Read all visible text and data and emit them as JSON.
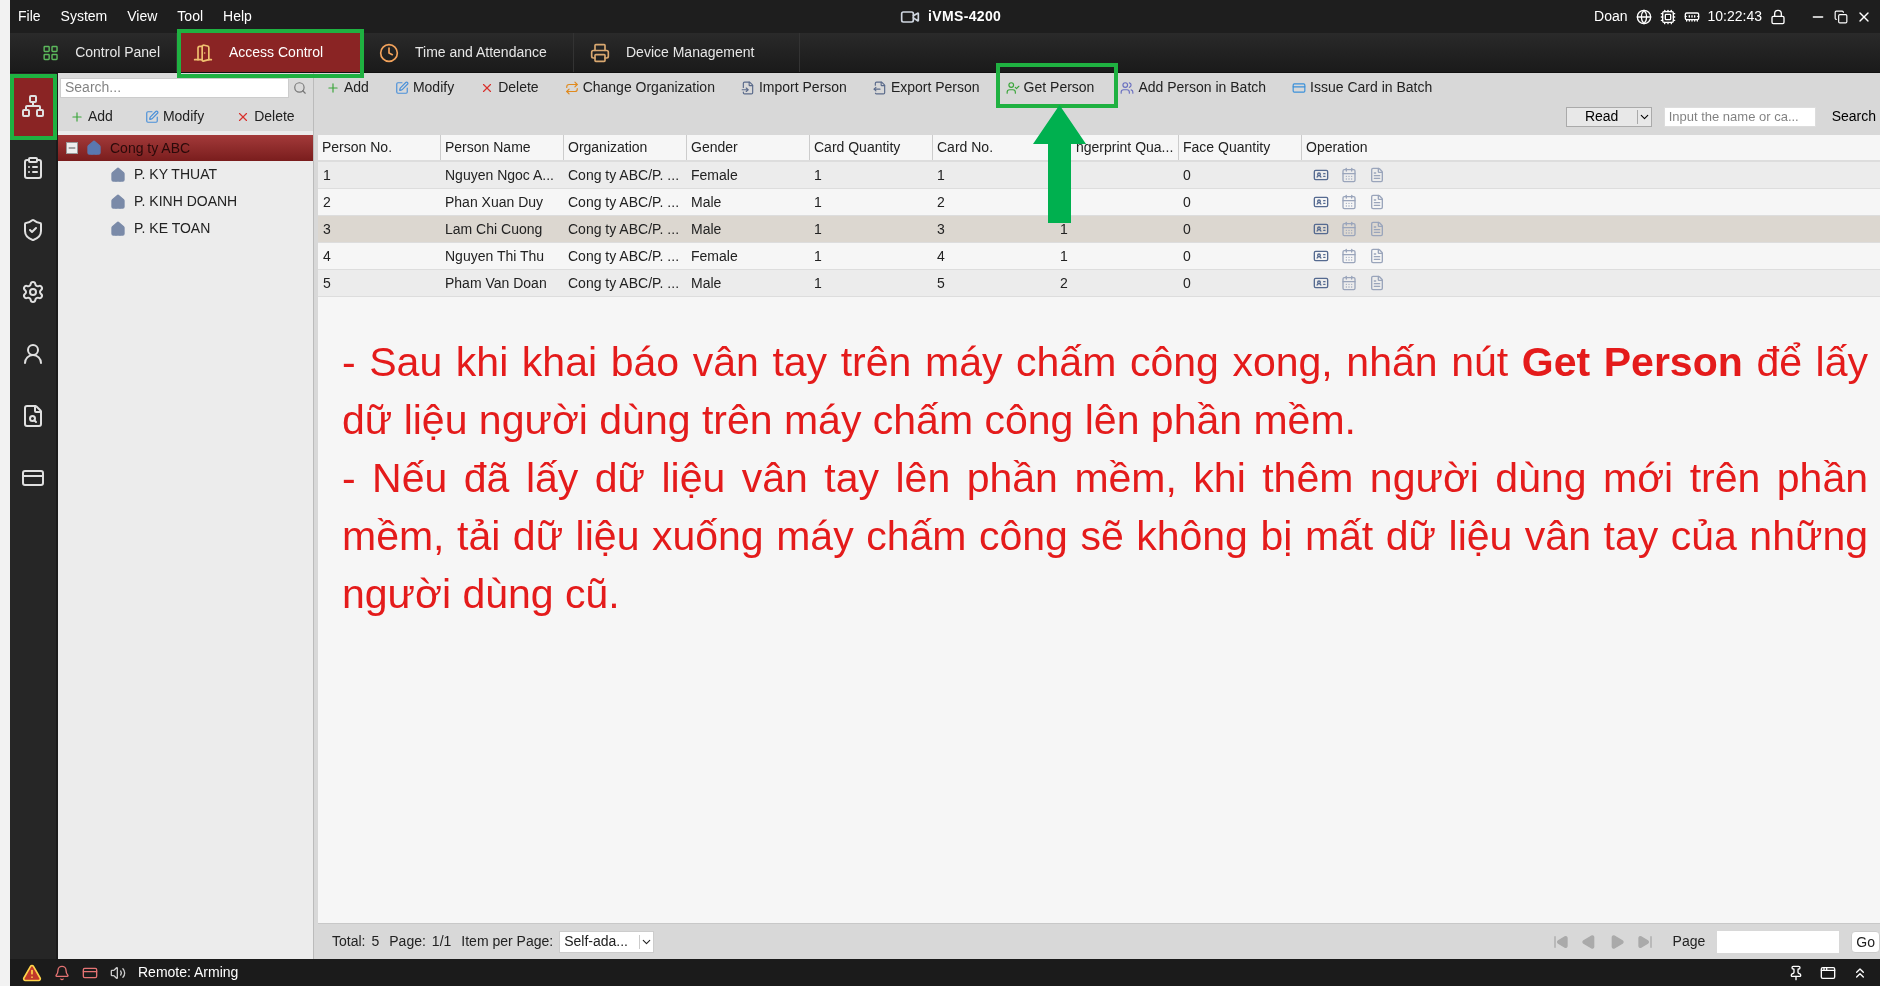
{
  "menu": [
    "File",
    "System",
    "View",
    "Tool",
    "Help"
  ],
  "window": {
    "title": "iVMS-4200",
    "user": "Doan",
    "time": "10:22:43"
  },
  "tabs": [
    {
      "label": "Control Panel",
      "kind": "grid",
      "selected": false
    },
    {
      "label": "Access Control",
      "kind": "door",
      "selected": true
    },
    {
      "label": "Time and Attendance",
      "kind": "clock",
      "selected": false
    },
    {
      "label": "Device Management",
      "kind": "device",
      "selected": false
    }
  ],
  "rail": [
    {
      "kind": "org",
      "selected": true
    },
    {
      "kind": "schedule",
      "selected": false
    },
    {
      "kind": "shield",
      "selected": false
    },
    {
      "kind": "gears",
      "selected": false
    },
    {
      "kind": "person",
      "selected": false
    },
    {
      "kind": "search",
      "selected": false
    },
    {
      "kind": "card",
      "selected": false
    }
  ],
  "tree_panel": {
    "search": {
      "placeholder": "Search..."
    },
    "toolbar": [
      {
        "label": "Add",
        "kind": "add"
      },
      {
        "label": "Modify",
        "kind": "modify"
      },
      {
        "label": "Delete",
        "kind": "delete"
      }
    ],
    "tree": [
      {
        "label": "Cong ty ABC",
        "selected": true,
        "expanded": true,
        "children": [
          {
            "label": "P. KY THUAT",
            "selected": false
          },
          {
            "label": "P. KINH DOANH",
            "selected": false
          },
          {
            "label": "P. KE TOAN",
            "selected": false
          }
        ]
      }
    ]
  },
  "toolbar": [
    {
      "label": "Add",
      "kind": "add"
    },
    {
      "label": "Modify",
      "kind": "modify"
    },
    {
      "label": "Delete",
      "kind": "delete"
    },
    {
      "label": "Change Organization",
      "kind": "org"
    },
    {
      "label": "Import Person",
      "kind": "import"
    },
    {
      "label": "Export Person",
      "kind": "export"
    },
    {
      "label": "Get Person",
      "kind": "get"
    },
    {
      "label": "Add Person in Batch",
      "kind": "batch"
    },
    {
      "label": "Issue Card in Batch",
      "kind": "card"
    }
  ],
  "filter": {
    "mode": "Read",
    "search": {
      "placeholder": "Input the name or ca..."
    },
    "button": "Search"
  },
  "table": {
    "columns": [
      "Person No.",
      "Person Name",
      "Organization",
      "Gender",
      "Card Quantity",
      "Card No.",
      "ngerprint Qua...",
      "Face Quantity",
      "Operation"
    ],
    "rows": [
      {
        "cells": [
          "1",
          "Nguyen Ngoc A...",
          "Cong ty ABC/P. ...",
          "Female",
          "1",
          "1",
          null,
          "0"
        ],
        "selected": false
      },
      {
        "cells": [
          "2",
          "Phan Xuan Duy",
          "Cong ty ABC/P. ...",
          "Male",
          "1",
          "2",
          null,
          "0"
        ],
        "selected": false
      },
      {
        "cells": [
          "3",
          "Lam Chi Cuong",
          "Cong ty ABC/P. ...",
          "Male",
          "1",
          "3",
          "1",
          "0"
        ],
        "selected": true
      },
      {
        "cells": [
          "4",
          "Nguyen Thi Thu",
          "Cong ty ABC/P. ...",
          "Female",
          "1",
          "4",
          "1",
          "0"
        ],
        "selected": false
      },
      {
        "cells": [
          "5",
          "Pham Van Doan",
          "Cong ty ABC/P. ...",
          "Male",
          "1",
          "5",
          "2",
          "0"
        ],
        "selected": false
      }
    ]
  },
  "note": [
    "- Sau khi khai báo vân tay trên máy chấm công xong, nhấn nút **Get Person** để lấy dữ liệu người dùng trên máy chấm công lên phần mềm.",
    "- Nếu đã lấy dữ liệu vân tay lên phần mềm, khi thêm người dùng mới trên phần mềm, tải dữ liệu xuống máy chấm công sẽ không bị mất dữ liệu vân tay của những người dùng cũ."
  ],
  "pagination": {
    "total_label": "Total:",
    "total": "5",
    "page_label": "Page:",
    "page": "1/1",
    "per_page_label": "Item per Page:",
    "per_page": "Self-ada...",
    "goto_label": "Page",
    "go": "Go"
  },
  "status_bar": {
    "text": "Remote: Arming"
  }
}
